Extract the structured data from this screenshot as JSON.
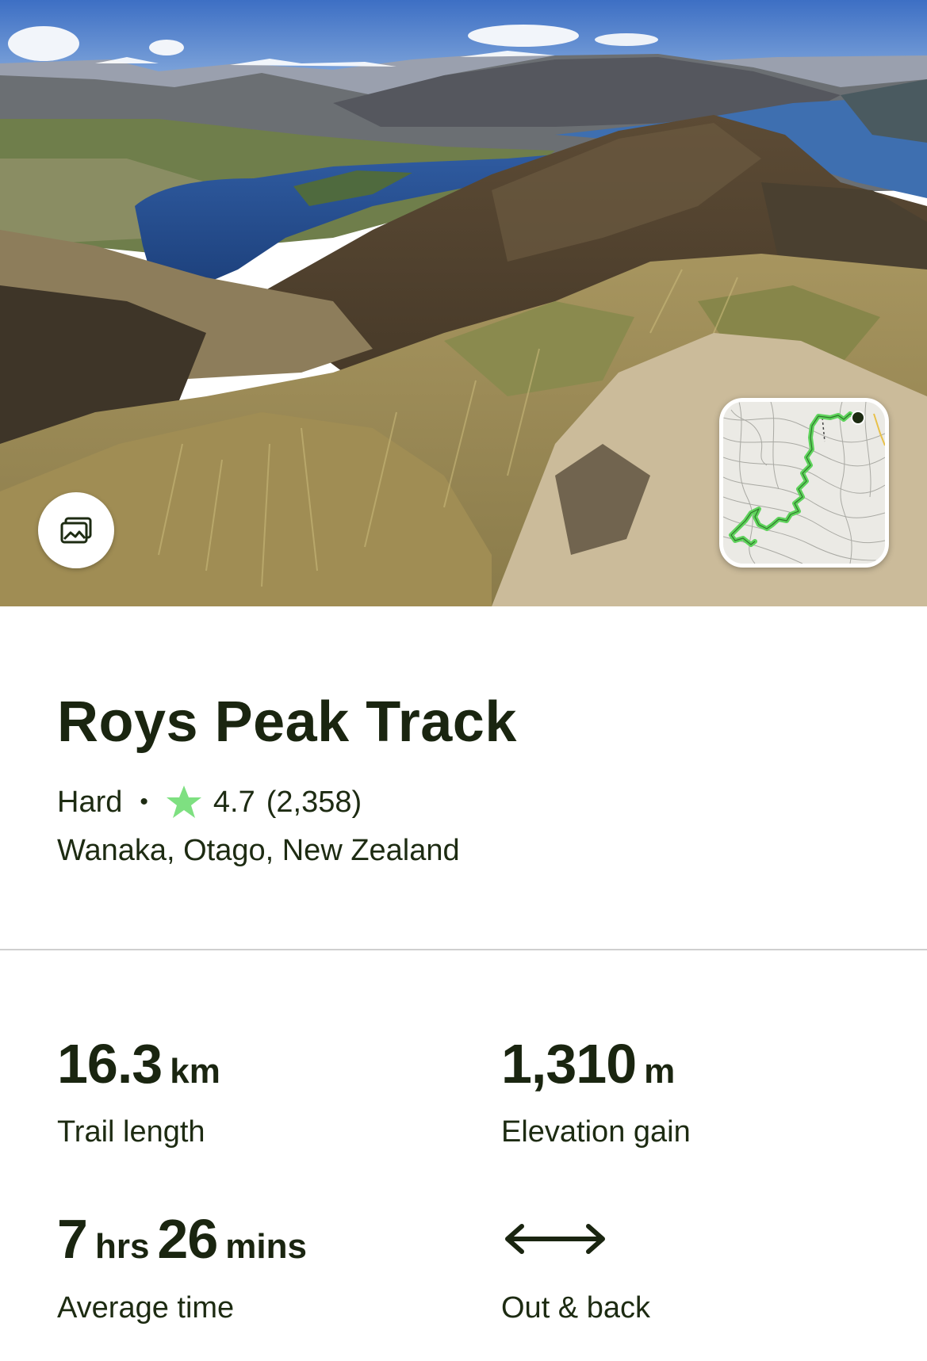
{
  "trail": {
    "name": "Roys Peak Track",
    "difficulty": "Hard",
    "separator": "•",
    "rating": "4.7",
    "review_count": "(2,358)",
    "location": "Wanaka, Otago, New Zealand"
  },
  "stats": {
    "length": {
      "value": "16.3",
      "unit": "km",
      "label": "Trail length"
    },
    "elevation": {
      "value": "1,310",
      "unit": "m",
      "label": "Elevation gain"
    },
    "time": {
      "hours": "7",
      "hours_unit": "hrs",
      "minutes": "26",
      "minutes_unit": "mins",
      "label": "Average time"
    },
    "route": {
      "icon": "double-arrow-icon",
      "label": "Out & back"
    }
  },
  "icons": {
    "gallery": "gallery-icon",
    "rating_star": "star-icon",
    "map": "trail-map-thumbnail"
  },
  "colors": {
    "text": "#1a2510",
    "star": "#7ee081",
    "trail_line": "#5fd35c",
    "divider": "#cfcfcf"
  }
}
